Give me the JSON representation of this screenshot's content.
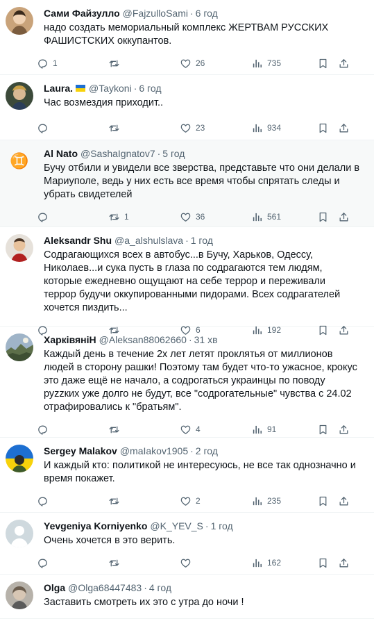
{
  "colors": {
    "text": "#0f1419",
    "muted": "#536471",
    "divider": "#eff3f4",
    "highlight_row": "#f7f9f9"
  },
  "icons": {
    "reply": "reply-icon",
    "retweet": "retweet-icon",
    "like": "heart-icon",
    "views": "views-icon",
    "bookmark": "bookmark-icon",
    "share": "share-icon"
  },
  "tweets": [
    {
      "name": "Сами Файзулло",
      "handle": "@FajzulloSami",
      "sep": "·",
      "time": "6 год",
      "text": "надо создать мемориальный комплекс ЖЕРТВАМ РУССКИХ ФАШИСТСКИХ оккупантов.",
      "replies": "1",
      "retweets": "",
      "likes": "26",
      "views": "735"
    },
    {
      "name": "Laura.",
      "handle": "@Taykoni",
      "sep": "·",
      "time": "6 год",
      "text": "Час возмездия приходит..",
      "replies": "",
      "retweets": "",
      "likes": "23",
      "views": "934"
    },
    {
      "name": "Al Nato",
      "handle": "@SashaIgnatov7",
      "sep": "·",
      "time": "5 год",
      "text": "Бучу отбили и увидели все зверства, представьте что они делали в Мариуполе, ведь у них есть все время чтобы спрятать следы и убрать свидетелей",
      "replies": "",
      "retweets": "1",
      "likes": "36",
      "views": "561"
    },
    {
      "name": "Aleksandr Shu",
      "handle": "@a_alshulslava",
      "sep": "·",
      "time": "1 год",
      "text": "Содрагающихся всех в автобус...в Бучу, Харьков, Одессу, Николаев...и сука пусть в глаза по содрагаются тем людям, которые ежедневно ощущают на себе террор и переживали террор будучи оккупированными пидорами. Всех содрагателей хочется пиздить...",
      "replies": "",
      "retweets": "",
      "likes": "6",
      "views": "192"
    },
    {
      "name": "ХарківяніН",
      "handle": "@Aleksan88062660",
      "sep": "·",
      "time": "31 хв",
      "text": "Каждый день в течение 2х лет летят проклятья от миллионов людей в сторону рашки! Поэтому там будет что-то ужасное, крокус это даже ещё не начало, а содрогаться украинцы по поводу руzzких уже долго не будут, все \"содрогательные\" чувства с 24.02 отрафировались к \"братьям\".",
      "replies": "",
      "retweets": "",
      "likes": "4",
      "views": "91"
    },
    {
      "name": "Sergey Malakov",
      "handle": "@maIakov1905",
      "sep": "·",
      "time": "2 год",
      "text": "И каждый кто: политикой не интересуюсь, не все так однозначно и время покажет.",
      "replies": "",
      "retweets": "",
      "likes": "2",
      "views": "235"
    },
    {
      "name": "Yevgeniya Korniyenko",
      "handle": "@K_YEV_S",
      "sep": "·",
      "time": "1 год",
      "text": "Очень хочется в это верить.",
      "replies": "",
      "retweets": "",
      "likes": "",
      "views": "162"
    },
    {
      "name": "Olga",
      "handle": "@Olga68447483",
      "sep": "·",
      "time": "4 год",
      "text": "Заставить смотреть их это с утра до ночи !",
      "replies": "",
      "retweets": "",
      "likes": "",
      "views": ""
    }
  ]
}
